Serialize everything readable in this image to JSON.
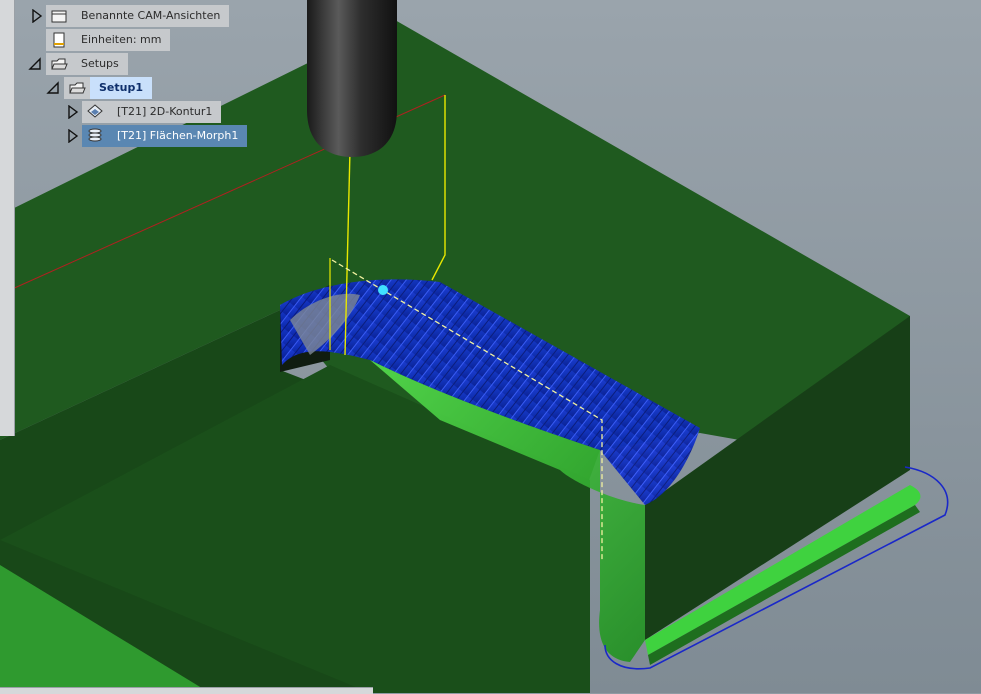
{
  "browser_tree": {
    "items": [
      {
        "label": "Benannte CAM-Ansichten",
        "icon": "folder-icon",
        "expander": "collapsed"
      },
      {
        "label": "Einheiten: mm",
        "icon": "document-icon",
        "expander": "none"
      },
      {
        "label": "Setups",
        "icon": "open-folder-icon",
        "expander": "expanded"
      },
      {
        "label": "Setup1",
        "icon": "open-folder-icon",
        "expander": "expanded",
        "selected": true
      },
      {
        "label": "[T21] 2D-Kontur1",
        "icon": "2d-contour-operation-icon",
        "expander": "collapsed"
      },
      {
        "label": "[T21] Flächen-Morph1",
        "icon": "surface-morph-operation-icon",
        "expander": "collapsed",
        "selected": true
      }
    ]
  },
  "colors": {
    "background": "#8f9aa3",
    "stock_top": "#1f5a1f",
    "stock_side": "#173f17",
    "toolpath": "#1a3fd6",
    "machined_surface": "#3fc93f",
    "tool": "#2a2a2a",
    "lead_move": "#e8e800",
    "rapid_move": "#b02020",
    "contour_outline": "#1a28c8"
  }
}
